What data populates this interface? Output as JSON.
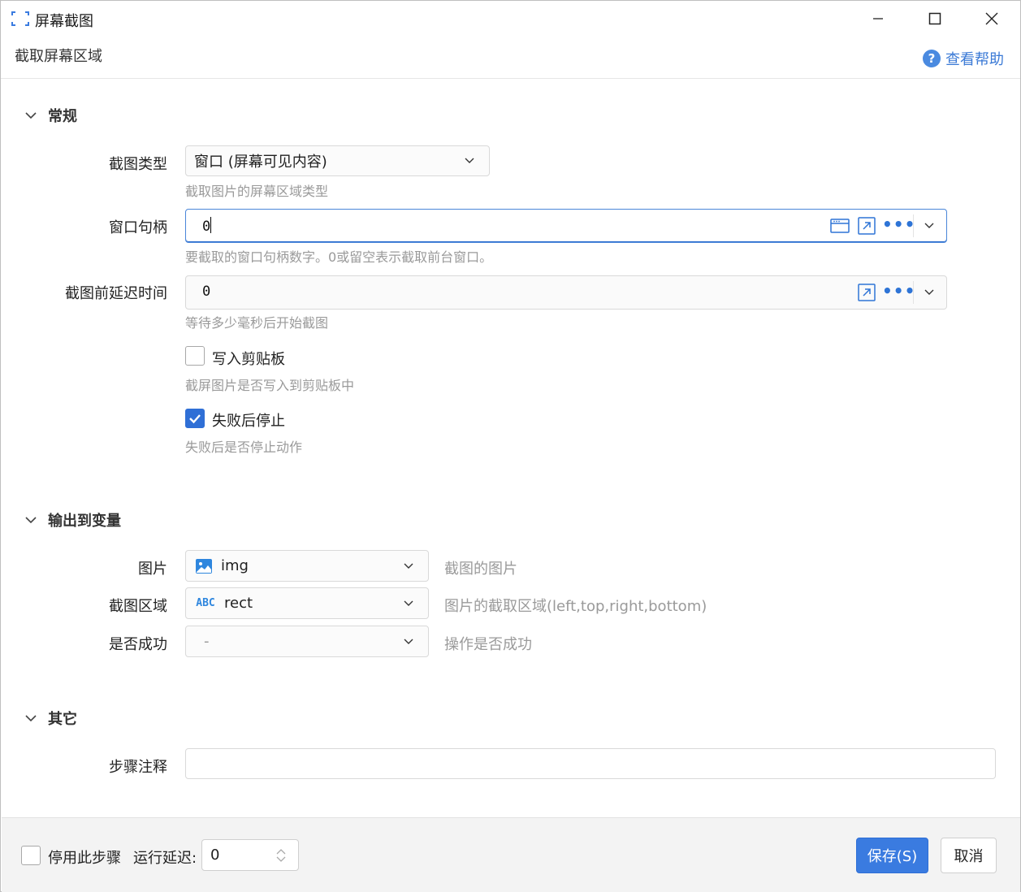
{
  "window": {
    "title": "屏幕截图",
    "subtitle": "截取屏幕区域",
    "help_label": "查看帮助"
  },
  "sections": {
    "general": {
      "title": "常规"
    },
    "output": {
      "title": "输出到变量"
    },
    "other": {
      "title": "其它"
    }
  },
  "general": {
    "capture_type": {
      "label": "截图类型",
      "value": "窗口 (屏幕可见内容)",
      "hint": "截取图片的屏幕区域类型"
    },
    "window_handle": {
      "label": "窗口句柄",
      "value": "0",
      "hint": "要截取的窗口句柄数字。0或留空表示截取前台窗口。"
    },
    "delay": {
      "label": "截图前延迟时间",
      "value": "0",
      "hint": "等待多少毫秒后开始截图"
    },
    "clipboard": {
      "label": "写入剪贴板",
      "checked": false,
      "hint": "截屏图片是否写入到剪贴板中"
    },
    "stop_on_fail": {
      "label": "失败后停止",
      "checked": true,
      "hint": "失败后是否停止动作"
    }
  },
  "output": {
    "image": {
      "label": "图片",
      "value": "img",
      "desc": "截图的图片",
      "icon": "image-icon"
    },
    "region": {
      "label": "截图区域",
      "value": "rect",
      "desc": "图片的截取区域(left,top,right,bottom)",
      "icon": "abc-icon"
    },
    "success": {
      "label": "是否成功",
      "value": "-",
      "desc": "操作是否成功"
    }
  },
  "other": {
    "comment": {
      "label": "步骤注释",
      "value": ""
    }
  },
  "footer": {
    "disable_label": "停用此步骤",
    "run_delay_label": "运行延迟:",
    "run_delay_value": "0",
    "save_label": "保存(S)",
    "cancel_label": "取消"
  },
  "colors": {
    "accent": "#3a7be0",
    "hint": "#9a9a9a",
    "link": "#3b7ad6"
  }
}
